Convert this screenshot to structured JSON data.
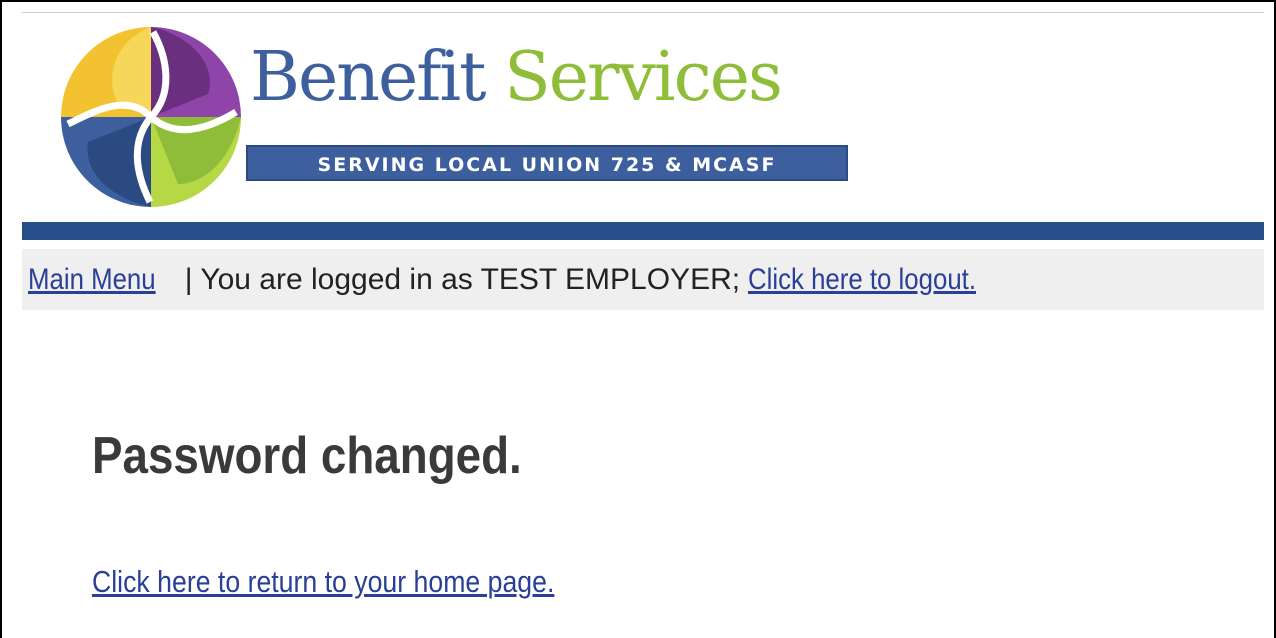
{
  "logo": {
    "word_primary": "Benefit",
    "word_secondary": "Services",
    "banner": "SERVING LOCAL UNION 725 & MCASF",
    "colors": {
      "blue": "#3d5f9e",
      "green": "#8fbd3a",
      "purple": "#8e44a8",
      "yellow": "#f2c230",
      "lime": "#b7d845"
    }
  },
  "nav": {
    "main_menu_label": "Main Menu",
    "separator": " | ",
    "logged_in_text": "You are logged in as TEST EMPLOYER; ",
    "logout_label": "Click here to logout."
  },
  "main": {
    "heading": "Password changed.",
    "home_link_label": "Click here to return to your home page."
  },
  "theme": {
    "bar_color": "#274f8c",
    "link_color": "#2a3f96",
    "strip_bg": "#efefef"
  }
}
